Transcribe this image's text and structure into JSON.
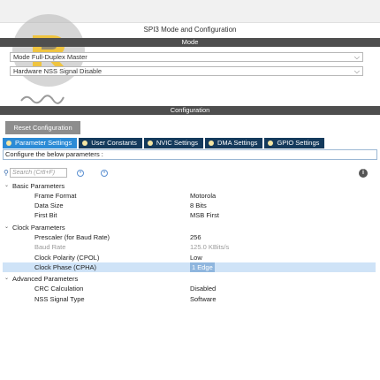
{
  "window": {
    "title": "SPI3 Mode and Configuration"
  },
  "mode": {
    "header": "Mode",
    "mode_select": {
      "label": "Mode",
      "value": "Full-Duplex Master"
    },
    "nss_select": {
      "label": "Hardware NSS Signal",
      "value": "Disable"
    }
  },
  "config": {
    "header": "Configuration",
    "reset_label": "Reset Configuration",
    "tabs": [
      {
        "label": "Parameter Settings",
        "active": true
      },
      {
        "label": "User Constants"
      },
      {
        "label": "NVIC Settings"
      },
      {
        "label": "DMA Settings"
      },
      {
        "label": "GPIO Settings"
      }
    ],
    "configure_text": "Configure the below parameters :",
    "search_placeholder": "Search (Crtl+F)",
    "groups": [
      {
        "name": "Basic Parameters",
        "params": [
          {
            "name": "Frame Format",
            "value": "Motorola"
          },
          {
            "name": "Data Size",
            "value": "8 Bits"
          },
          {
            "name": "First Bit",
            "value": "MSB First"
          }
        ]
      },
      {
        "name": "Clock Parameters",
        "params": [
          {
            "name": "Prescaler (for Baud Rate)",
            "value": "256"
          },
          {
            "name": "Baud Rate",
            "value": "125.0 KBits/s",
            "dim": true
          },
          {
            "name": "Clock Polarity (CPOL)",
            "value": "Low"
          },
          {
            "name": "Clock Phase (CPHA)",
            "value": "1 Edge",
            "selected": true
          }
        ]
      },
      {
        "name": "Advanced Parameters",
        "params": [
          {
            "name": "CRC Calculation",
            "value": "Disabled"
          },
          {
            "name": "NSS Signal Type",
            "value": "Software"
          }
        ]
      }
    ]
  },
  "colors": {
    "section_bar": "#4e4e4e",
    "tab": "#143a5c",
    "tab_active": "#2b8bd6",
    "selected_row": "#cfe3f7"
  }
}
